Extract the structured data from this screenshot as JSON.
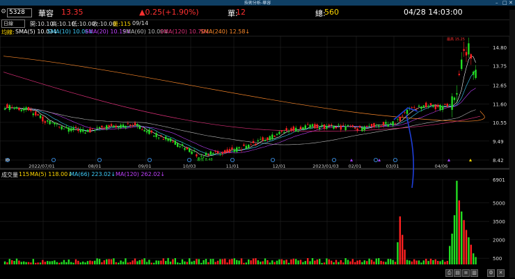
{
  "window": {
    "title": "技術分析-華容"
  },
  "header": {
    "stock_code": "5328",
    "stock_name": "華容",
    "price": "13.35",
    "change": "▲0.25(+1.90%)",
    "volume_label": "單:",
    "volume": "12",
    "total_label": "總:",
    "total": "560",
    "datetime": "04/28 14:03:00"
  },
  "quote": {
    "freq": "日線",
    "open": "開:10.10",
    "high": "高:10.10",
    "low": "低:10.00",
    "close": "收:10.00",
    "vol": "量:115",
    "date": "09/14"
  },
  "ma": {
    "label": "均線:",
    "sma5": "SMA(5) 10.03↓",
    "sma10": "SMA(10) 10.06↓",
    "sma20": "SMA(20) 10.19↓",
    "sma60": "SMA(60) 10.00↓",
    "sma120": "SMA(120) 10.70↓",
    "sma240": "SMA(240) 12.58↓"
  },
  "volume_panel": {
    "label": "成交量",
    "value": "115",
    "ma5": "MA(5) 118.00↓",
    "ma66": "MA(66) 223.02↓",
    "ma120": "MA(120) 262.02↓"
  },
  "price_axis": [
    "14.80",
    "13.75",
    "12.65",
    "11.60",
    "10.55",
    "9.49",
    "8.42"
  ],
  "volume_axis": [
    "6901",
    "5000",
    "3500",
    "2000",
    "500"
  ],
  "date_axis": [
    "2022/07/01",
    "08/01",
    "09/01",
    "10/03",
    "11/01",
    "12/01",
    "2023/01/03",
    "02/01",
    "03/01",
    "04/06"
  ],
  "annotations": {
    "high_tag": "最高 15.25",
    "low_tag": "最低 8.48"
  },
  "colors": {
    "up": "#ff2020",
    "down": "#22dd22",
    "sma5": "#ffffff",
    "sma10": "#3fd0ff",
    "sma20": "#c040ff",
    "sma60": "#bbbbbb",
    "sma120": "#e0307a",
    "sma240": "#ff8a2a",
    "accent": "#ffd700",
    "pen": "#1f3fd9"
  },
  "toolbar": {
    "icons": [
      "print-icon",
      "save-icon",
      "list-icon",
      "chart-icon",
      "settings-icon",
      "close-icon"
    ]
  }
}
